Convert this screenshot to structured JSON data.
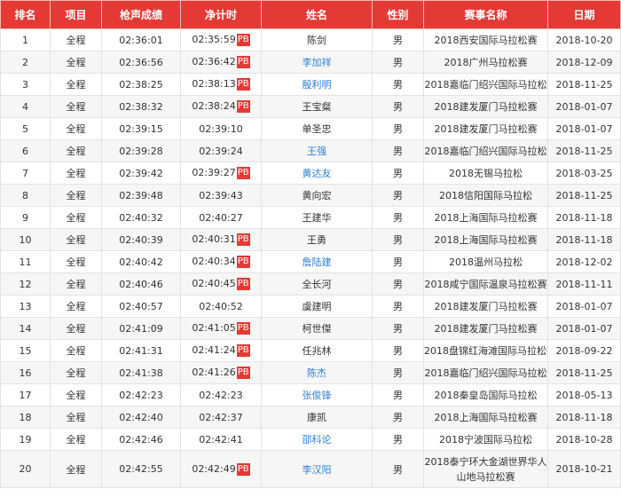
{
  "headers": [
    "排名",
    "项目",
    "枪声成绩",
    "净计时",
    "姓名",
    "性别",
    "赛事名称",
    "日期"
  ],
  "pb_label": "PB",
  "rows": [
    {
      "rank": "1",
      "event_type": "全程",
      "gun": "02:36:01",
      "net": "02:35:59",
      "pb": true,
      "name": "陈剑",
      "link": false,
      "gender": "男",
      "race": "2018西安国际马拉松赛",
      "date": "2018-10-20"
    },
    {
      "rank": "2",
      "event_type": "全程",
      "gun": "02:36:56",
      "net": "02:36:42",
      "pb": true,
      "name": "李加祥",
      "link": true,
      "gender": "男",
      "race": "2018广州马拉松赛",
      "date": "2018-12-09"
    },
    {
      "rank": "3",
      "event_type": "全程",
      "gun": "02:38:25",
      "net": "02:38:13",
      "pb": true,
      "name": "殷利明",
      "link": true,
      "gender": "男",
      "race": "2018嘉临门绍兴国际马拉松",
      "date": "2018-11-25"
    },
    {
      "rank": "4",
      "event_type": "全程",
      "gun": "02:38:32",
      "net": "02:38:24",
      "pb": true,
      "name": "王宝粲",
      "link": false,
      "gender": "男",
      "race": "2018建发厦门马拉松赛",
      "date": "2018-01-07"
    },
    {
      "rank": "5",
      "event_type": "全程",
      "gun": "02:39:15",
      "net": "02:39:10",
      "pb": false,
      "name": "单圣忠",
      "link": false,
      "gender": "男",
      "race": "2018建发厦门马拉松赛",
      "date": "2018-01-07"
    },
    {
      "rank": "6",
      "event_type": "全程",
      "gun": "02:39:28",
      "net": "02:39:24",
      "pb": false,
      "name": "王强",
      "link": true,
      "gender": "男",
      "race": "2018嘉临门绍兴国际马拉松",
      "date": "2018-11-25"
    },
    {
      "rank": "7",
      "event_type": "全程",
      "gun": "02:39:42",
      "net": "02:39:27",
      "pb": true,
      "name": "黄达友",
      "link": true,
      "gender": "男",
      "race": "2018无锡马拉松",
      "date": "2018-03-25"
    },
    {
      "rank": "8",
      "event_type": "全程",
      "gun": "02:39:48",
      "net": "02:39:43",
      "pb": false,
      "name": "黄向宏",
      "link": false,
      "gender": "男",
      "race": "2018信阳国际马拉松",
      "date": "2018-11-25"
    },
    {
      "rank": "9",
      "event_type": "全程",
      "gun": "02:40:32",
      "net": "02:40:27",
      "pb": false,
      "name": "王建华",
      "link": false,
      "gender": "男",
      "race": "2018上海国际马拉松赛",
      "date": "2018-11-18"
    },
    {
      "rank": "10",
      "event_type": "全程",
      "gun": "02:40:39",
      "net": "02:40:31",
      "pb": true,
      "name": "王勇",
      "link": false,
      "gender": "男",
      "race": "2018上海国际马拉松赛",
      "date": "2018-11-18"
    },
    {
      "rank": "11",
      "event_type": "全程",
      "gun": "02:40:42",
      "net": "02:40:34",
      "pb": true,
      "name": "詹陆建",
      "link": true,
      "gender": "男",
      "race": "2018温州马拉松",
      "date": "2018-12-02"
    },
    {
      "rank": "12",
      "event_type": "全程",
      "gun": "02:40:46",
      "net": "02:40:45",
      "pb": true,
      "name": "全长河",
      "link": false,
      "gender": "男",
      "race": "2018咸宁国际温泉马拉松赛",
      "date": "2018-11-11"
    },
    {
      "rank": "13",
      "event_type": "全程",
      "gun": "02:40:57",
      "net": "02:40:52",
      "pb": false,
      "name": "虞建明",
      "link": false,
      "gender": "男",
      "race": "2018建发厦门马拉松赛",
      "date": "2018-01-07"
    },
    {
      "rank": "14",
      "event_type": "全程",
      "gun": "02:41:09",
      "net": "02:41:05",
      "pb": true,
      "name": "柯世傑",
      "link": false,
      "gender": "男",
      "race": "2018建发厦门马拉松赛",
      "date": "2018-01-07"
    },
    {
      "rank": "15",
      "event_type": "全程",
      "gun": "02:41:31",
      "net": "02:41:24",
      "pb": true,
      "name": "任兆林",
      "link": false,
      "gender": "男",
      "race": "2018盘锦红海滩国际马拉松赛",
      "date": "2018-09-22"
    },
    {
      "rank": "16",
      "event_type": "全程",
      "gun": "02:41:38",
      "net": "02:41:26",
      "pb": true,
      "name": "陈杰",
      "link": true,
      "gender": "男",
      "race": "2018嘉临门绍兴国际马拉松",
      "date": "2018-11-25"
    },
    {
      "rank": "17",
      "event_type": "全程",
      "gun": "02:42:23",
      "net": "02:42:23",
      "pb": false,
      "name": "张俊锋",
      "link": true,
      "gender": "男",
      "race": "2018秦皇岛国际马拉松",
      "date": "2018-05-13"
    },
    {
      "rank": "18",
      "event_type": "全程",
      "gun": "02:42:40",
      "net": "02:42:37",
      "pb": false,
      "name": "康凯",
      "link": false,
      "gender": "男",
      "race": "2018上海国际马拉松赛",
      "date": "2018-11-18"
    },
    {
      "rank": "19",
      "event_type": "全程",
      "gun": "02:42:46",
      "net": "02:42:41",
      "pb": false,
      "name": "邵科论",
      "link": true,
      "gender": "男",
      "race": "2018宁波国际马拉松",
      "date": "2018-10-28"
    },
    {
      "rank": "20",
      "event_type": "全程",
      "gun": "02:42:55",
      "net": "02:42:49",
      "pb": true,
      "name": "李汉阳",
      "link": true,
      "gender": "男",
      "race": "2018泰宁环大金湖世界华人山地马拉松赛",
      "date": "2018-10-21"
    }
  ]
}
